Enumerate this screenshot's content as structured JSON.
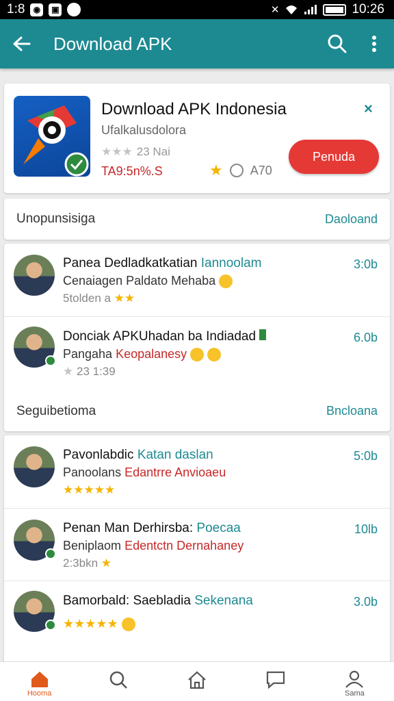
{
  "status_bar": {
    "time_left": "1:8",
    "time_right": "10:26"
  },
  "app_bar": {
    "title": "Download APK"
  },
  "hero": {
    "title": "Download APK Indonesia",
    "subtitle": "Ufalkalusdolora",
    "rating": "23 Nai",
    "size": "TA9:5n%.S",
    "meta": "A70",
    "install_label": "Penuda",
    "close_glyph": "×"
  },
  "section1": {
    "label": "Unopunsisiga",
    "link": "Daoloand"
  },
  "list1": [
    {
      "title": "Panea Dedladkatkatian",
      "title_hl": "Iannoolam",
      "sub": "Cenaiagen Paldato Mehaba",
      "sub_red": "",
      "meta": "5tolden a",
      "size": "3:0b"
    },
    {
      "title": "Donciak APKUhadan ba Indiadad",
      "title_hl": "",
      "sub": "Pangaha",
      "sub_red": "Keopalanesy",
      "meta": "23  1:39",
      "size": "6.0b"
    }
  ],
  "section2": {
    "label": "Seguibetioma",
    "link": "Bncloana"
  },
  "list2": [
    {
      "title": "Pavonlabdic",
      "title_hl": "Katan daslan",
      "sub": "Panoolans",
      "sub_red": "Edantrre Anvioaeu",
      "meta": "",
      "size": "5:0b"
    },
    {
      "title": "Penan Man Derhirsba:",
      "title_hl": "Poecaa",
      "sub": "Beniplaom",
      "sub_red": "Edentctn Dernahaney",
      "meta": "2:3bkn",
      "size": "10lb"
    },
    {
      "title": "Bamorbald: Saebladia",
      "title_hl": "Sekenana",
      "sub": "",
      "sub_red": "",
      "meta": "",
      "size": "3.0b"
    }
  ],
  "bottom_nav": [
    {
      "label": "Hooma",
      "icon": "home-icon"
    },
    {
      "label": "",
      "icon": "search-icon"
    },
    {
      "label": "",
      "icon": "house-outline-icon"
    },
    {
      "label": "",
      "icon": "chat-icon"
    },
    {
      "label": "Sama",
      "icon": "profile-icon"
    }
  ],
  "colors": {
    "primary": "#1d8a92",
    "install": "#e53935",
    "accent": "#e05a1c"
  }
}
